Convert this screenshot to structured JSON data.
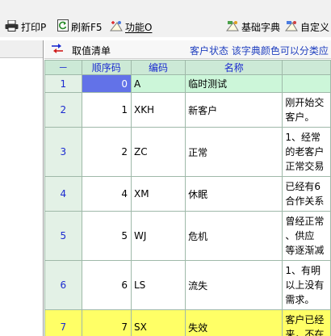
{
  "toolbar": {
    "print_label": "打印P",
    "refresh_label": "刷新F5",
    "function_label": "功能O",
    "dict_label": "基础字典",
    "custom_label": "自定义"
  },
  "header": {
    "title": "取值清单",
    "status_text": "客户状态  该字典颜色可以分类应"
  },
  "table": {
    "columns": [
      "－",
      "顺序码",
      "编码",
      "名称",
      ""
    ],
    "rows": [
      {
        "rownum": "1",
        "order": "0",
        "code": "A",
        "name": "临时测试",
        "desc": [
          "",
          "",
          ""
        ]
      },
      {
        "rownum": "2",
        "order": "1",
        "code": "XKH",
        "name": "新客户",
        "desc": [
          "刚开始交",
          "客户。",
          ""
        ]
      },
      {
        "rownum": "3",
        "order": "2",
        "code": "ZC",
        "name": "正常",
        "desc": [
          "1、经常",
          "的老客户",
          "正常交易"
        ]
      },
      {
        "rownum": "4",
        "order": "4",
        "code": "XM",
        "name": "休眠",
        "desc": [
          "已经有6",
          "合作关系",
          ""
        ]
      },
      {
        "rownum": "5",
        "order": "5",
        "code": "WJ",
        "name": "危机",
        "desc": [
          "曾经正常",
          "、供应",
          "等逐渐减"
        ]
      },
      {
        "rownum": "6",
        "order": "6",
        "code": "LS",
        "name": "流失",
        "desc": [
          "1、有明",
          "以上没有",
          "需求。"
        ]
      },
      {
        "rownum": "7",
        "order": "7",
        "code": "SX",
        "name": "失效",
        "desc": [
          "客户已经",
          "来，不在",
          ""
        ]
      }
    ]
  },
  "colors": {
    "header_green": "#cce9d6",
    "selected_blue": "#6272e8",
    "highlight_yellow": "#ffff66"
  },
  "icons": [
    "printer-icon",
    "refresh-icon",
    "function-icon",
    "dictionary-icon",
    "custom-icon",
    "sort-icon"
  ]
}
